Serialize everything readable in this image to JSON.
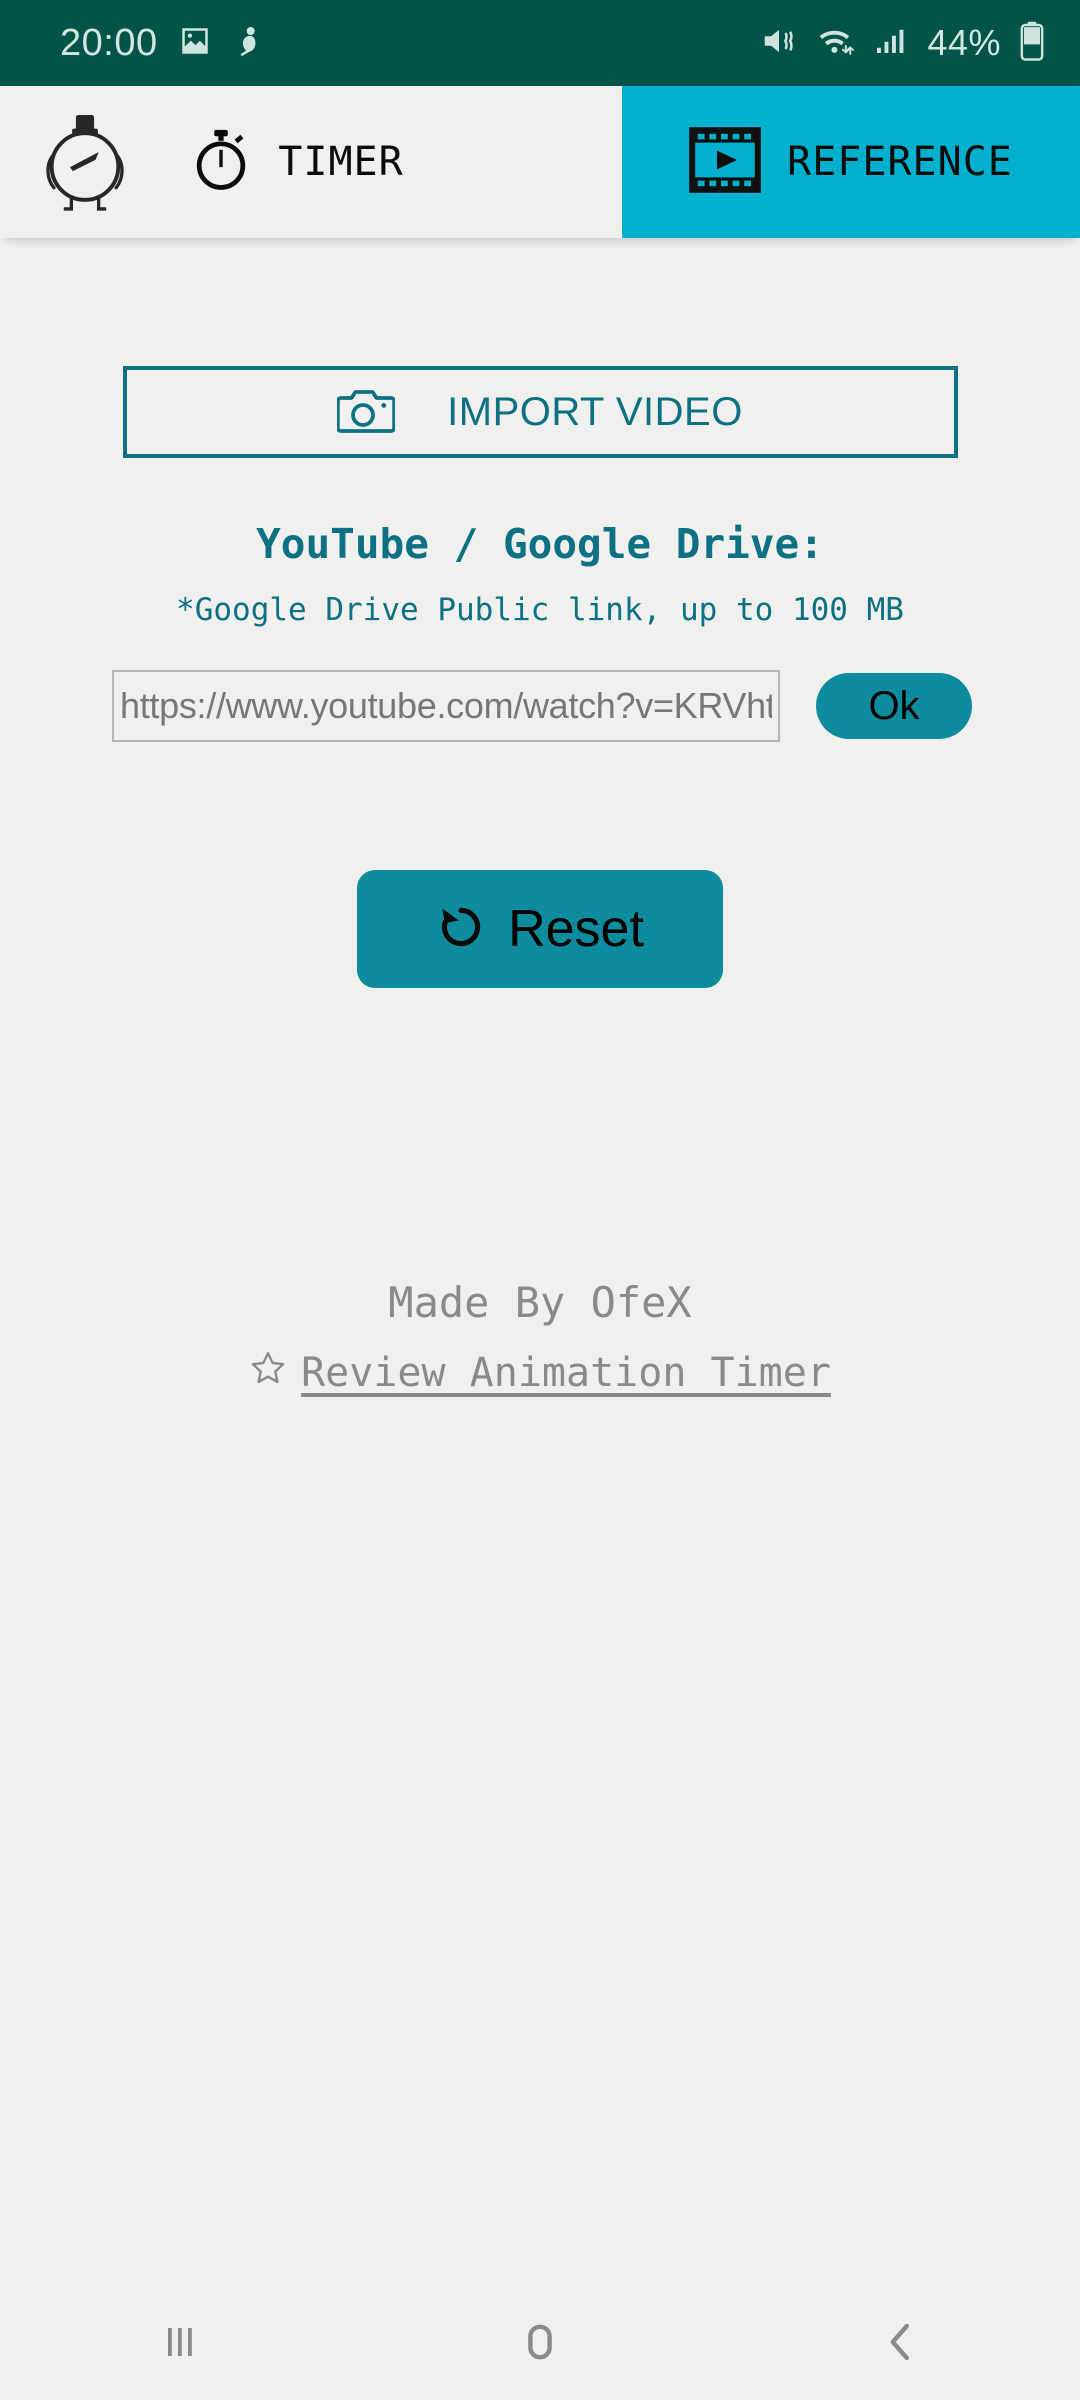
{
  "status_bar": {
    "time": "20:00",
    "battery_percent": "44%",
    "left_icons": [
      "image-icon",
      "person-figure-icon"
    ],
    "right_icons": [
      "mute-vibrate-icon",
      "wifi-icon",
      "signal-bars-icon",
      "battery-icon"
    ],
    "background_color": "#015447"
  },
  "tabs": {
    "app_logo_icon": "stopwatch-mascot-logo",
    "items": [
      {
        "label": "TIMER",
        "icon": "stopwatch-icon",
        "active": false
      },
      {
        "label": "REFERENCE",
        "icon": "film-strip-icon",
        "active": true
      }
    ],
    "active_color": "#00b0cc",
    "inactive_color": "#f0f0ef"
  },
  "main": {
    "import_button": {
      "label": "IMPORT VIDEO",
      "icon": "camera-icon"
    },
    "source_title": "YouTube / Google Drive:",
    "source_note": "*Google Drive Public link, up to 100 MB",
    "url_field": {
      "value": "https://www.youtube.com/watch?v=KRVht",
      "placeholder": "https://"
    },
    "ok_button": {
      "label": "Ok"
    },
    "reset_button": {
      "label": "Reset",
      "icon": "rotate-ccw-icon"
    }
  },
  "footer": {
    "made_by": "Made By OfeX",
    "review_link": "Review Animation Timer",
    "review_star_icon": "star-outline-icon"
  },
  "nav_bar": {
    "recents_label": "recents-icon",
    "home_label": "home-icon",
    "back_label": "back-icon"
  },
  "colors": {
    "accent_teal": "#0d7083",
    "button_teal": "#0e8c9e",
    "tab_cyan": "#00b0cc",
    "status_green": "#015447",
    "background": "#f0f0ef",
    "muted_text": "#8a8a8a"
  }
}
